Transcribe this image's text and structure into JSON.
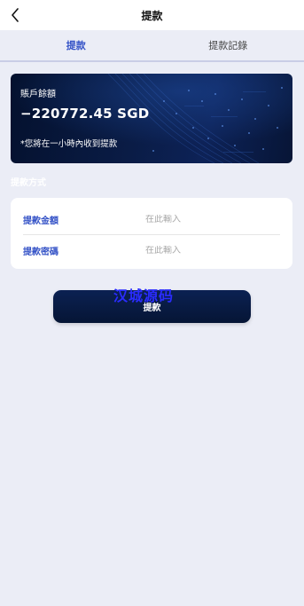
{
  "header": {
    "title": "提款",
    "back_icon": "chevron-left-icon"
  },
  "tabs": [
    {
      "label": "提款",
      "active": true
    },
    {
      "label": "提款記錄",
      "active": false
    }
  ],
  "balance": {
    "label": "賬戶餘額",
    "amount": "−220772.45 SGD",
    "note": "*您將在一小時內收到提款"
  },
  "section": {
    "label": "提款方式"
  },
  "form": {
    "amount_label": "提款金額",
    "amount_placeholder": "在此輸入",
    "password_label": "提款密碼",
    "password_placeholder": "在此輸入"
  },
  "submit": {
    "label": "提款"
  },
  "watermark": {
    "text": "汉城源码"
  },
  "colors": {
    "accent": "#3553c7",
    "card_bg": "#0a1c46",
    "page_bg": "#ebedf6"
  }
}
